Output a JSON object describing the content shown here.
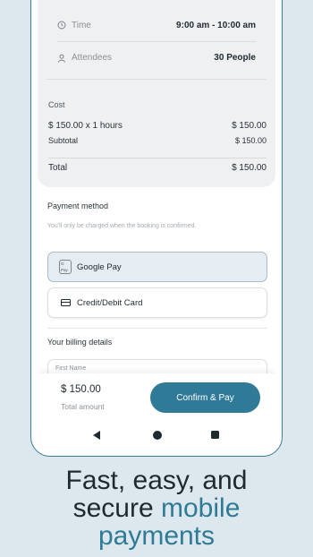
{
  "booking": {
    "time_label": "Time",
    "time_value": "9:00 am - 10:00 am",
    "attendees_label": "Attendees",
    "attendees_value": "30 People"
  },
  "cost": {
    "title": "Cost",
    "line_label": "$ 150.00 x 1 hours",
    "line_value": "$ 150.00",
    "subtotal_label": "Subtotal",
    "subtotal_value": "$ 150.00",
    "total_label": "Total",
    "total_value": "$ 150.00"
  },
  "payment": {
    "title": "Payment method",
    "note": "You'll only be charged when the booking is confirmed.",
    "options": [
      {
        "label": "Google Pay",
        "icon": "google-pay-icon",
        "badge": "G Pay",
        "selected": true
      },
      {
        "label": "Credit/Debit Card",
        "icon": "credit-card-icon",
        "selected": false
      }
    ]
  },
  "billing": {
    "title": "Your billing details",
    "first_name_placeholder": "First Name"
  },
  "footer": {
    "amount": "$ 150.00",
    "amount_label": "Total amount",
    "confirm_label": "Confirm & Pay"
  },
  "navbar": {
    "icons": [
      "back-icon",
      "home-icon",
      "recents-icon"
    ]
  },
  "tagline": {
    "line1": "Fast, easy, and",
    "line2_plain": "secure ",
    "line2_accent": "mobile",
    "line3_accent": "payments"
  },
  "colors": {
    "accent": "#2f7a96",
    "background": "#dde8ee",
    "selected_option": "#e6edf2"
  }
}
